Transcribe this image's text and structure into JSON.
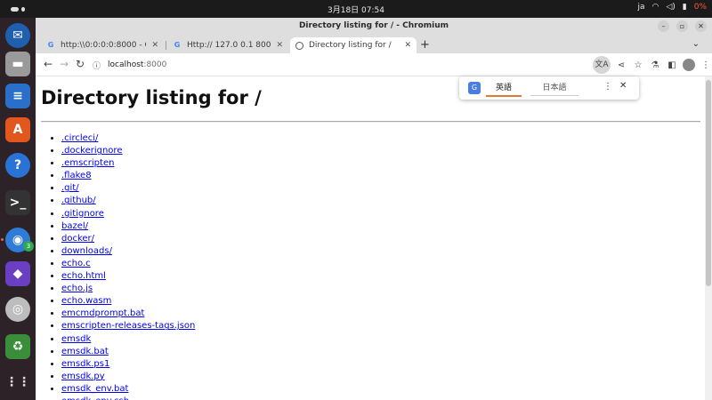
{
  "system": {
    "clock": "3月18日  07:54",
    "input_method": "ja",
    "battery": "0%"
  },
  "window": {
    "title": "Directory listing for / - Chromium"
  },
  "tabs": [
    {
      "label": "http:\\\\0:0:0:0:8000 - Goog",
      "icon": "google-icon"
    },
    {
      "label": "Http:// 127.0 0.1 8000 - Go",
      "icon": "google-icon"
    },
    {
      "label": "Directory listing for /",
      "icon": "globe-icon"
    }
  ],
  "address": {
    "host": "localhost",
    "port": ":8000"
  },
  "translate_popup": {
    "selected_lang": "英語",
    "other_lang": "日本語"
  },
  "page": {
    "heading": "Directory listing for /",
    "files": [
      ".circleci/",
      ".dockerignore",
      ".emscripten",
      ".flake8",
      ".git/",
      ".github/",
      ".gitignore",
      "bazel/",
      "docker/",
      "downloads/",
      "echo.c",
      "echo.html",
      "echo.js",
      "echo.wasm",
      "emcmdprompt.bat",
      "emscripten-releases-tags.json",
      "emsdk",
      "emsdk.bat",
      "emsdk.ps1",
      "emsdk.py",
      "emsdk_env.bat",
      "emsdk_env.csh"
    ]
  },
  "dock": {
    "chrome_badge": "3"
  }
}
